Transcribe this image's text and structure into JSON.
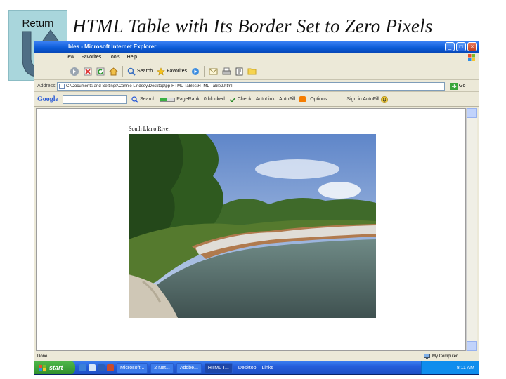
{
  "slide": {
    "return_label": "Return",
    "title": "HTML Table with Its Border Set to Zero Pixels"
  },
  "window": {
    "title": "bles - Microsoft Internet Explorer",
    "controls": [
      "_",
      "□",
      "×"
    ]
  },
  "menu": [
    "iew",
    "Favorites",
    "Tools",
    "Help"
  ],
  "toolbar": {
    "back_label": "",
    "search_label": "Search",
    "favorites_label": "Favorites"
  },
  "address": {
    "label": "Address",
    "value": "C:\\Documents and Settings\\Connie Lindsey\\Desktop\\pp-HTML-Tables\\HTML-Table2.html",
    "go_label": "Go"
  },
  "google_bar": {
    "logo": "Google",
    "search_label": "Search",
    "items": [
      "PageRank",
      "0 blocked",
      "Check",
      "AutoLink",
      "AutoFill",
      "Options"
    ],
    "signin_label": "Sign in AutoFill"
  },
  "page": {
    "caption": "South Llano River"
  },
  "status": {
    "left": "Done",
    "zone": "My Computer"
  },
  "taskbar": {
    "start_label": "start",
    "items": [
      "Microsoft...",
      "2 Net...",
      "Adobe...",
      "HTML T...",
      "Desktop",
      "Links"
    ],
    "clock": "8:11 AM"
  },
  "colors": {
    "return_bg": "#a9d6dc",
    "arrow": "#4f6e85",
    "titlebar": "#0a5ad6",
    "taskbar": "#245edb",
    "start": "#3f9f39"
  }
}
